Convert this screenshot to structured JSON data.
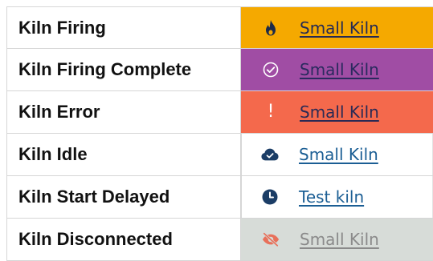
{
  "rows": [
    {
      "label": "Kiln Firing",
      "link": "Small Kiln",
      "icon": "flame-icon",
      "bg": "#f5a900",
      "link_color": "#242a55"
    },
    {
      "label": "Kiln Firing Complete",
      "link": "Small Kiln",
      "icon": "check-circle-icon",
      "bg": "#a04da4",
      "link_color": "#2a2a5e"
    },
    {
      "label": "Kiln Error",
      "link": "Small Kiln",
      "icon": "exclamation-icon",
      "icon_text": "!",
      "bg": "#f4694c",
      "link_color": "#2a2a55"
    },
    {
      "label": "Kiln Idle",
      "link": "Small Kiln",
      "icon": "cloud-check-icon",
      "bg": "#ffffff",
      "link_color": "#1b5e94"
    },
    {
      "label": "Kiln Start Delayed",
      "link": "Test kiln",
      "icon": "clock-icon",
      "bg": "#ffffff",
      "link_color": "#1b5e94"
    },
    {
      "label": "Kiln Disconnected",
      "link": "Small Kiln",
      "icon": "eye-slash-icon",
      "bg": "#d7dcd8",
      "link_color": "#8a8a8a"
    }
  ],
  "colors": {
    "firing": "#f5a900",
    "complete": "#a04da4",
    "error": "#f4694c",
    "disconnected": "#d7dcd8",
    "icon_dark": "#1b3d66",
    "icon_disconnected": "#e8705a"
  }
}
